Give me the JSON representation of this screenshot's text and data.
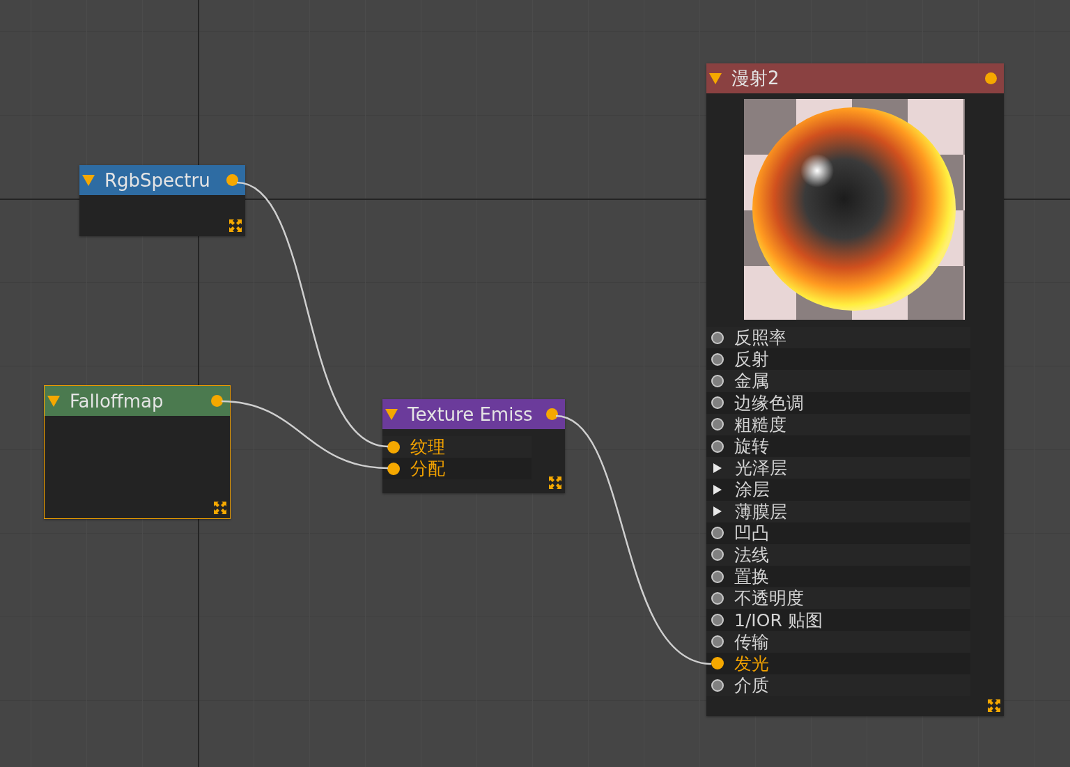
{
  "nodes": [
    {
      "title": "RgbSpectru",
      "color": "#2e6ca3",
      "selected": false
    },
    {
      "title": "Falloffmap",
      "color": "#4b7a4f",
      "selected": true
    },
    {
      "title": "Texture Emiss",
      "color": "#6b3b9b",
      "selected": false,
      "inputs": [
        {
          "label": "纹理",
          "kind": "socket",
          "connected": true
        },
        {
          "label": "分配",
          "kind": "socket",
          "connected": true
        }
      ]
    },
    {
      "title": "漫射2",
      "color": "#8a4141",
      "selected": false,
      "has_preview": true,
      "inputs": [
        {
          "label": "反照率",
          "kind": "socket",
          "connected": false
        },
        {
          "label": "反射",
          "kind": "socket",
          "connected": false
        },
        {
          "label": "金属",
          "kind": "socket",
          "connected": false
        },
        {
          "label": "边缘色调",
          "kind": "socket",
          "connected": false
        },
        {
          "label": "粗糙度",
          "kind": "socket",
          "connected": false
        },
        {
          "label": "旋转",
          "kind": "socket",
          "connected": false
        },
        {
          "label": "光泽层",
          "kind": "group",
          "expanded": false
        },
        {
          "label": "涂层",
          "kind": "group",
          "expanded": false
        },
        {
          "label": "薄膜层",
          "kind": "group",
          "expanded": false
        },
        {
          "label": "凹凸",
          "kind": "socket",
          "connected": false
        },
        {
          "label": "法线",
          "kind": "socket",
          "connected": false
        },
        {
          "label": "置换",
          "kind": "socket",
          "connected": false
        },
        {
          "label": "不透明度",
          "kind": "socket",
          "connected": false
        },
        {
          "label": "1/IOR 贴图",
          "kind": "socket",
          "connected": false
        },
        {
          "label": "传输",
          "kind": "socket",
          "connected": false
        },
        {
          "label": "发光",
          "kind": "socket",
          "connected": true
        },
        {
          "label": "介质",
          "kind": "socket",
          "connected": false
        }
      ]
    }
  ]
}
